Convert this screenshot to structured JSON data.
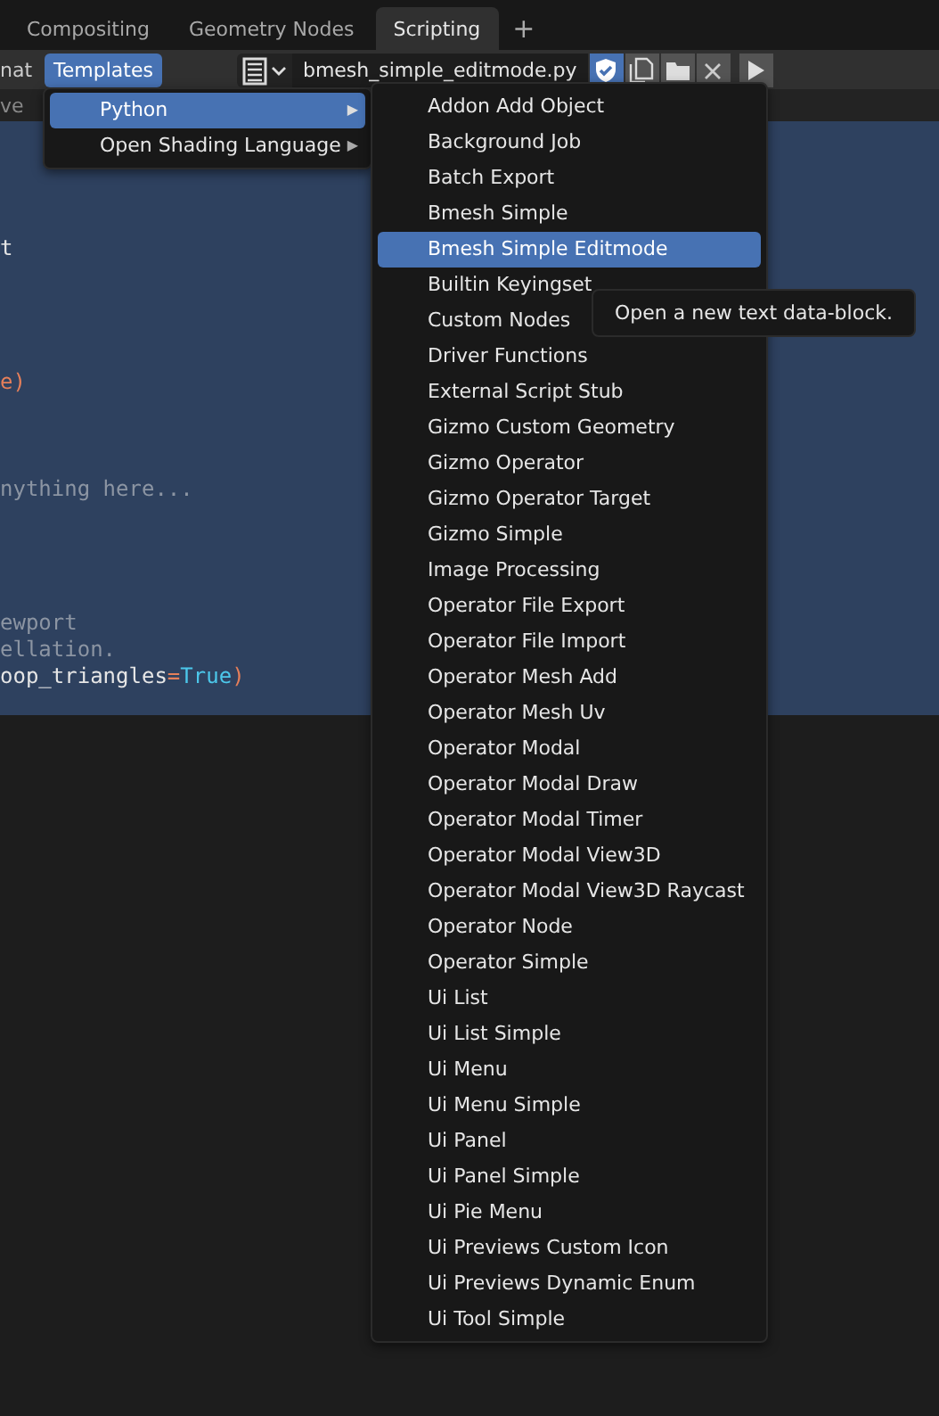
{
  "workspace_tabs": [
    {
      "label": "Compositing",
      "selected": false
    },
    {
      "label": "Geometry Nodes",
      "selected": false
    },
    {
      "label": "Scripting",
      "selected": true
    }
  ],
  "add_tab": "+",
  "header": {
    "menu_cut": "nat",
    "templates": {
      "label": "Templates",
      "open": true
    },
    "filename": "bmesh_simple_editmode.py",
    "fake_user": true
  },
  "subheader_cut": "ve",
  "code_lines": [
    {
      "segments": [
        {
          "kind": "text",
          "text": "t"
        }
      ]
    },
    {
      "segments": [
        {
          "kind": "operator",
          "text": "e)"
        }
      ]
    },
    {
      "segments": [
        {
          "kind": "comment",
          "text": "nything here..."
        }
      ]
    },
    {
      "segments": [
        {
          "kind": "comment",
          "text": "ewport"
        }
      ]
    },
    {
      "segments": [
        {
          "kind": "comment",
          "text": "ellation."
        }
      ]
    },
    {
      "segments": [
        {
          "kind": "text",
          "text": "oop_triangles"
        },
        {
          "kind": "operator",
          "text": "="
        },
        {
          "kind": "constant",
          "text": "True"
        },
        {
          "kind": "operator",
          "text": ")"
        }
      ]
    }
  ],
  "templates_menu": [
    {
      "label": "Python",
      "arrow": "▶",
      "selected": true
    },
    {
      "label": "Open Shading Language",
      "arrow": "▶",
      "selected": false
    }
  ],
  "python_menu": [
    {
      "label": "Addon Add Object",
      "selected": false
    },
    {
      "label": "Background Job",
      "selected": false
    },
    {
      "label": "Batch Export",
      "selected": false
    },
    {
      "label": "Bmesh Simple",
      "selected": false
    },
    {
      "label": "Bmesh Simple Editmode",
      "selected": true
    },
    {
      "label": "Builtin Keyingset",
      "selected": false
    },
    {
      "label": "Custom Nodes",
      "selected": false
    },
    {
      "label": "Driver Functions",
      "selected": false
    },
    {
      "label": "External Script Stub",
      "selected": false
    },
    {
      "label": "Gizmo Custom Geometry",
      "selected": false
    },
    {
      "label": "Gizmo Operator",
      "selected": false
    },
    {
      "label": "Gizmo Operator Target",
      "selected": false
    },
    {
      "label": "Gizmo Simple",
      "selected": false
    },
    {
      "label": "Image Processing",
      "selected": false
    },
    {
      "label": "Operator File Export",
      "selected": false
    },
    {
      "label": "Operator File Import",
      "selected": false
    },
    {
      "label": "Operator Mesh Add",
      "selected": false
    },
    {
      "label": "Operator Mesh Uv",
      "selected": false
    },
    {
      "label": "Operator Modal",
      "selected": false
    },
    {
      "label": "Operator Modal Draw",
      "selected": false
    },
    {
      "label": "Operator Modal Timer",
      "selected": false
    },
    {
      "label": "Operator Modal View3D",
      "selected": false
    },
    {
      "label": "Operator Modal View3D Raycast",
      "selected": false
    },
    {
      "label": "Operator Node",
      "selected": false
    },
    {
      "label": "Operator Simple",
      "selected": false
    },
    {
      "label": "Ui List",
      "selected": false
    },
    {
      "label": "Ui List Simple",
      "selected": false
    },
    {
      "label": "Ui Menu",
      "selected": false
    },
    {
      "label": "Ui Menu Simple",
      "selected": false
    },
    {
      "label": "Ui Panel",
      "selected": false
    },
    {
      "label": "Ui Panel Simple",
      "selected": false
    },
    {
      "label": "Ui Pie Menu",
      "selected": false
    },
    {
      "label": "Ui Previews Custom Icon",
      "selected": false
    },
    {
      "label": "Ui Previews Dynamic Enum",
      "selected": false
    },
    {
      "label": "Ui Tool Simple",
      "selected": false
    }
  ],
  "tooltip": "Open a new text data-block."
}
